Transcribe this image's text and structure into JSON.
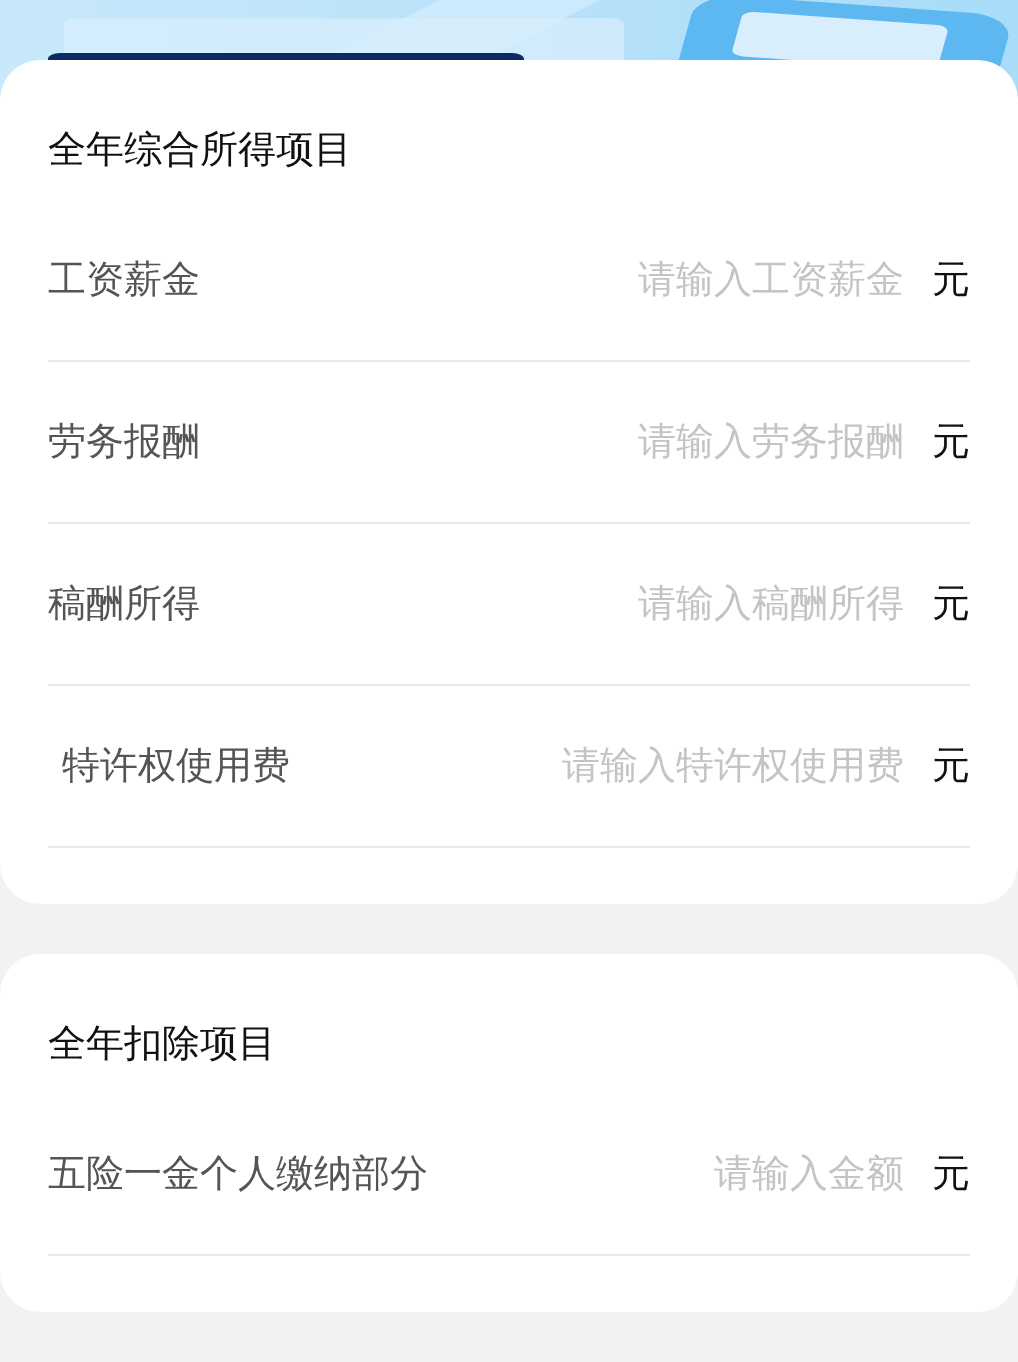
{
  "sections": [
    {
      "title": "全年综合所得项目",
      "rows": [
        {
          "kind": "plain",
          "label": "工资薪金",
          "placeholder": "请输入工资薪金",
          "unit": "元"
        },
        {
          "kind": "plain",
          "label": "劳务报酬",
          "placeholder": "请输入劳务报酬",
          "unit": "元"
        },
        {
          "kind": "plain",
          "label": "稿酬所得",
          "placeholder": "请输入稿酬所得",
          "unit": "元"
        },
        {
          "kind": "wrapped",
          "label": "特许权使用费",
          "placeholder": "请输入特许权使用费",
          "unit": "元"
        }
      ]
    },
    {
      "title": "全年扣除项目",
      "rows": [
        {
          "kind": "plain",
          "label": "五险一金个人缴纳部分",
          "placeholder": "请输入金额",
          "unit": "元"
        }
      ]
    }
  ]
}
